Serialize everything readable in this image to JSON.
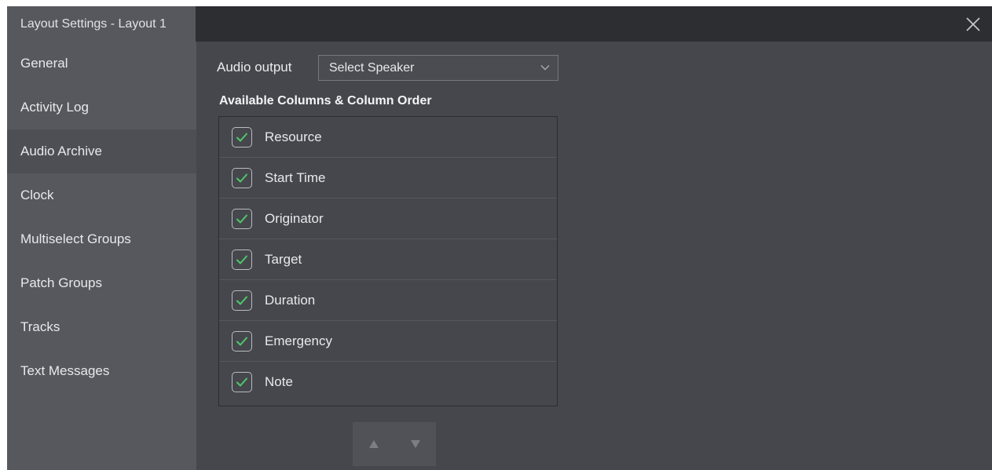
{
  "window": {
    "title": "Layout Settings - Layout 1",
    "close_icon": "close-icon"
  },
  "sidebar": {
    "items": [
      {
        "label": "General",
        "active": false
      },
      {
        "label": "Activity Log",
        "active": false
      },
      {
        "label": "Audio Archive",
        "active": true
      },
      {
        "label": "Clock",
        "active": false
      },
      {
        "label": "Multiselect Groups",
        "active": false
      },
      {
        "label": "Patch Groups",
        "active": false
      },
      {
        "label": "Tracks",
        "active": false
      },
      {
        "label": "Text Messages",
        "active": false
      }
    ]
  },
  "audio": {
    "label": "Audio output",
    "selected": "Select Speaker",
    "icon": "chevron-down-icon"
  },
  "columns": {
    "heading": "Available Columns & Column Order",
    "items": [
      {
        "label": "Resource",
        "checked": true
      },
      {
        "label": "Start Time",
        "checked": true
      },
      {
        "label": "Originator",
        "checked": true
      },
      {
        "label": "Target",
        "checked": true
      },
      {
        "label": "Duration",
        "checked": true
      },
      {
        "label": "Emergency",
        "checked": true
      },
      {
        "label": "Note",
        "checked": true
      }
    ],
    "move_up_icon": "arrow-up-icon",
    "move_down_icon": "arrow-down-icon"
  },
  "colors": {
    "check_accent": "#4fc86a",
    "window_bg": "#45474d",
    "sidebar_bg": "#56585e",
    "titlebar_bg": "#2d2e31"
  }
}
